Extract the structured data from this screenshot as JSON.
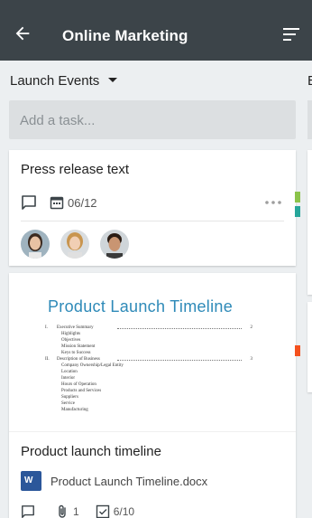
{
  "appbar": {
    "title": "Online Marketing",
    "back_icon": "arrow-left-icon",
    "sort_icon": "sort-icon",
    "background": "#3c4449"
  },
  "column": {
    "header": "Launch Events",
    "add_task_placeholder": "Add a task..."
  },
  "next_column": {
    "header_peek": "E"
  },
  "cards": [
    {
      "title": "Press release text",
      "due_date": "06/12",
      "icons": [
        "comment-icon",
        "calendar-icon",
        "more-icon"
      ]
    },
    {
      "title": "Product launch timeline",
      "attachment": "Product Launch Timeline.docx",
      "attachment_icon": "W",
      "attachments_count": "1",
      "checklist": "6/10",
      "preview": {
        "title": "Product Launch Timeline",
        "toc": [
          {
            "num": "I.",
            "label": "Executive Summary",
            "page": "2"
          },
          {
            "num": "",
            "label": "Highlights",
            "page": ""
          },
          {
            "num": "",
            "label": "Objectives",
            "page": ""
          },
          {
            "num": "",
            "label": "Mission Statement",
            "page": ""
          },
          {
            "num": "",
            "label": "Keys to Success",
            "page": ""
          },
          {
            "num": "II.",
            "label": "Description of Business",
            "page": "3"
          },
          {
            "num": "",
            "label": "Company Ownership/Legal Entity",
            "page": ""
          },
          {
            "num": "",
            "label": "Location",
            "page": ""
          },
          {
            "num": "",
            "label": "Interior",
            "page": ""
          },
          {
            "num": "",
            "label": "Hours of Operation",
            "page": ""
          },
          {
            "num": "",
            "label": "Products and Services",
            "page": ""
          },
          {
            "num": "",
            "label": "Suppliers",
            "page": ""
          },
          {
            "num": "",
            "label": "Service",
            "page": ""
          },
          {
            "num": "",
            "label": "Manufacturing",
            "page": ""
          }
        ]
      }
    }
  ],
  "colors": {
    "accent": "#2e8ab8",
    "word": "#2b579a",
    "label_green": "#8bc34a",
    "label_teal": "#26a69a",
    "label_orange": "#f4511e"
  }
}
